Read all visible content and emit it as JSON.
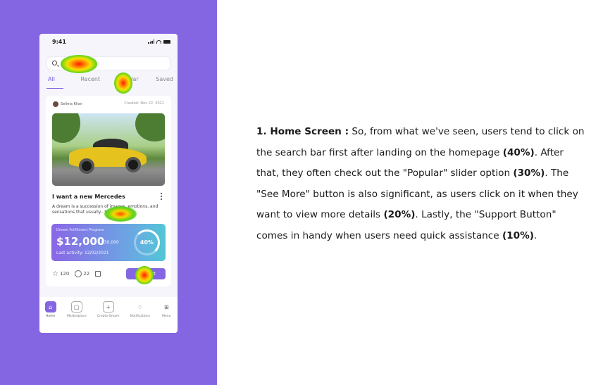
{
  "phone": {
    "status_time": "9:41",
    "tabs": [
      "All",
      "Recent",
      "Popular",
      "Saved"
    ],
    "card": {
      "author": "Selima Khan",
      "created": "Created: Nov 22, 2021",
      "title": "I want a new Mercedes",
      "description": "A dream is a succession of images, emotions, and sensations that usually...See More",
      "progress": {
        "label": "Dream Fulfillment Progress",
        "amount": "$12,000",
        "total": "/ $30,000",
        "last_activity": "Last activity: 12/02/2021",
        "percent": "40%"
      },
      "stars": "120",
      "comments": "22",
      "support_label": "Support"
    },
    "nav": [
      {
        "label": "Home",
        "icon": "home-icon"
      },
      {
        "label": "Marketplace",
        "icon": "shop-icon"
      },
      {
        "label": "Create Dream",
        "icon": "plus-icon"
      },
      {
        "label": "Notifications",
        "icon": "bell-icon"
      },
      {
        "label": "Menu",
        "icon": "grid-icon"
      }
    ]
  },
  "explanation": {
    "heading": "1. Home Screen :",
    "part1": " So, from what we've seen, users tend to click on the search bar first after landing on the homepage ",
    "pct1": "(40%)",
    "part2": ". After that, they often check out the \"Popular\" slider option ",
    "pct2": "(30%)",
    "part3": ". The \"See More\" button is also significant, as users click on it when they want to view more details ",
    "pct3": "(20%)",
    "part4": ". Lastly, the \"Support Button\" comes in handy when users need quick assistance ",
    "pct4": "(10%)",
    "part5": "."
  },
  "colors": {
    "left_panel": "#8566e2",
    "accent": "#7a5ce0"
  }
}
